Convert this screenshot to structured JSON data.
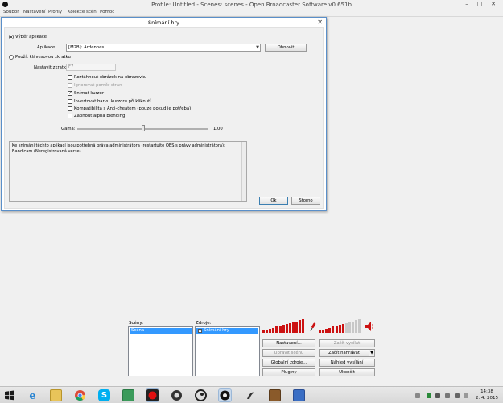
{
  "window": {
    "title": "Profile: Untitled - Scenes: scenes - Open Broadcaster Software v0.651b",
    "controls": {
      "minimize": "–",
      "maximize": "□",
      "close": "✕"
    }
  },
  "menu": [
    "Soubor",
    "Nastavení",
    "Profily",
    "Kolekce scén",
    "Pomoc"
  ],
  "dialog": {
    "title": "Snímání hry",
    "close": "✕",
    "mode_app_label": "Výběr aplikace",
    "mode_hotkey_label": "Použít klávesovou zkratku",
    "application_label": "Aplikace:",
    "application_value": "[M2B]: Ardennes",
    "refresh_label": "Obnovit",
    "hotkey_label": "Nastavit zkratku",
    "hotkey_value": "F7",
    "checkboxes": [
      {
        "label": "Roztáhnout obrázek na obrazovku",
        "checked": false,
        "disabled": false
      },
      {
        "label": "Ignorovat poměr stran",
        "checked": false,
        "disabled": true
      },
      {
        "label": "Snímat kurzor",
        "checked": true,
        "disabled": false
      },
      {
        "label": "Invertovat barvu kurzoru při kliknutí",
        "checked": false,
        "disabled": false
      },
      {
        "label": "Kompatibilita s Anti-cheatem (pouze pokud je potřeba)",
        "checked": false,
        "disabled": false
      },
      {
        "label": "Zapnout alpha blending",
        "checked": false,
        "disabled": false
      }
    ],
    "gamma_label": "Gama:",
    "gamma_value": "1.00",
    "gamma_level": 0.5,
    "info_text_line1": "Ke snímání těchto aplikací jsou potřebná práva administrátora (restartujte OBS s právy administrátora):",
    "info_text_line2": "Bandicam (Neregistrovaná verze)",
    "ok_label": "Ok",
    "cancel_label": "Storno",
    "check_mark": "✓"
  },
  "panels": {
    "scenes_label": "Scény:",
    "scenes": [
      "Scéna"
    ],
    "sources_label": "Zdroje:",
    "sources": [
      {
        "label": "Snímání hry",
        "checked": true
      }
    ]
  },
  "controls": {
    "settings": "Nastavení...",
    "start_stream": "Začít vysílat",
    "edit_scene": "Upravit scénu",
    "start_record": "Začít nahrávat",
    "global_sources": "Globální zdroje...",
    "preview": "Náhled vysílání",
    "plugins": "Pluginy",
    "exit": "Ukončit",
    "dropdown_arrow": "▼"
  },
  "meters": {
    "mic_level": 0.95,
    "desktop_level": 0.6
  },
  "colors": {
    "accent": "#3399ff",
    "meter_active": "#cc1111",
    "meter_inactive": "#c8c8c8",
    "dialog_border": "#5a8fc9"
  },
  "taskbar": {
    "time": "14:38",
    "date": "2. 4. 2015",
    "icons": [
      "start-icon",
      "ie-icon",
      "explorer-icon",
      "chrome-icon",
      "skype-icon",
      "maps-icon",
      "bandicam-icon",
      "obs-icon",
      "steam-icon",
      "obs-active-icon",
      "tool-icon",
      "game-icon",
      "app-icon"
    ]
  }
}
